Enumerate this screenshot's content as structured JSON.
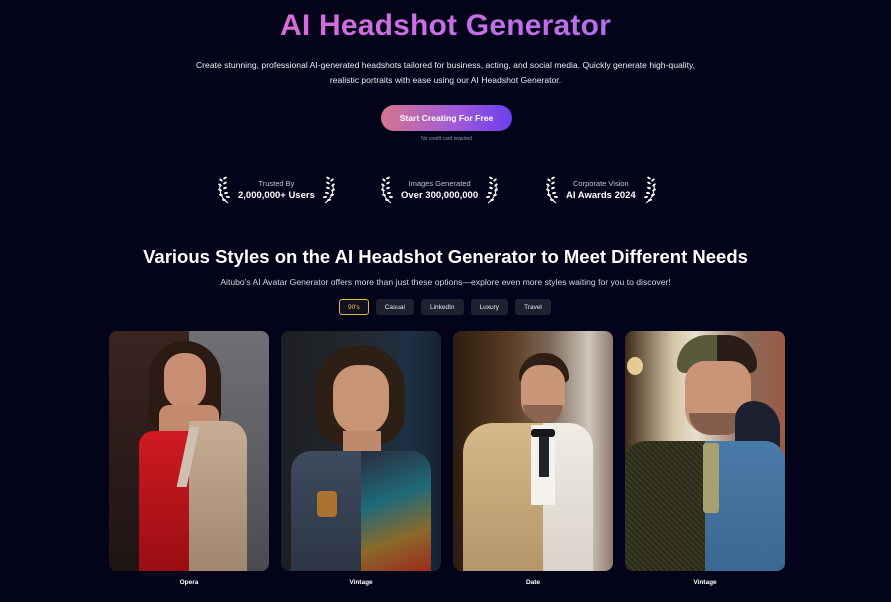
{
  "hero": {
    "title": "AI Headshot Generator",
    "subtitle": "Create stunning, professional AI-generated headshots tailored for business, acting, and social media. Quickly generate high-quality, realistic portraits with ease using our AI Headshot Generator.",
    "cta_label": "Start Creating For Free",
    "cta_note": "No credit card required",
    "gradient_colors": [
      "#f06ac6",
      "#9a6cf2"
    ]
  },
  "stats": [
    {
      "label": "Trusted By",
      "value": "2,000,000+ Users",
      "icon": "laurel-icon"
    },
    {
      "label": "Images Generated",
      "value": "Over 300,000,000",
      "icon": "laurel-icon"
    },
    {
      "label": "Corporate Vision",
      "value": "AI Awards 2024",
      "icon": "laurel-icon"
    }
  ],
  "styles_section": {
    "title": "Various Styles on the AI Headshot Generator to Meet Different Needs",
    "subtitle": "Aitubo's AI Avatar Generator offers more than just these options—explore even more styles waiting for you to discover!",
    "tabs": [
      {
        "label": "90's",
        "active": true
      },
      {
        "label": "Casual",
        "active": false
      },
      {
        "label": "LinkedIn",
        "active": false
      },
      {
        "label": "Luxury",
        "active": false
      },
      {
        "label": "Travel",
        "active": false
      }
    ],
    "active_color": "#e5b83a",
    "cards": [
      {
        "label": "Opera",
        "image": "woman in red satin dress / beige blazer split portrait"
      },
      {
        "label": "Vintage",
        "image": "curly-haired woman in denim shirt / graphic tee split portrait"
      },
      {
        "label": "Date",
        "image": "man in beige suit with bow tie / white suit split portrait"
      },
      {
        "label": "Vintage",
        "image": "man in flat cap and tweed jacket / denim jacket split portrait"
      }
    ]
  }
}
